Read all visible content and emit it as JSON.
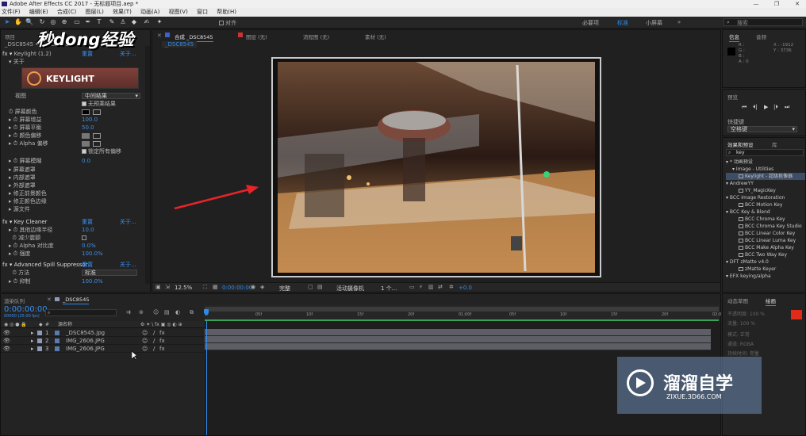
{
  "app": {
    "title": "Adobe After Effects CC 2017 - 无标题项目.aep *",
    "win_minimize": "—",
    "win_maximize": "❐",
    "win_close": "✕"
  },
  "menu": [
    "文件(F)",
    "编辑(E)",
    "合成(C)",
    "图层(L)",
    "效果(T)",
    "动画(A)",
    "视图(V)",
    "窗口",
    "帮助(H)"
  ],
  "toolbar": {
    "snap_label": "对齐",
    "workspaces": [
      "必要项",
      "标准",
      "小屏幕"
    ],
    "active_workspace": "标准",
    "search_placeholder": "搜索",
    "more": "»"
  },
  "left_panel": {
    "tab_project": "项目",
    "tab_effect_controls": "效果控件",
    "layer_name": "_DSC8545 • _DSC8545",
    "effect_name": "Keylight (1.2)",
    "reset": "重置",
    "about": "关于...",
    "about_label": "关于",
    "logo_text": "KEYLIGHT",
    "view_label": "视图",
    "view_value": "中间结果",
    "unpremultiply_label": "无预乘结果",
    "props": [
      {
        "label": "屏幕颜色",
        "value": ""
      },
      {
        "label": "屏幕增益",
        "value": "100.0"
      },
      {
        "label": "屏幕平衡",
        "value": "50.0"
      },
      {
        "label": "颜色偏移",
        "value": ""
      },
      {
        "label": "Alpha 偏移",
        "value": ""
      }
    ],
    "lock_bias_label": "锁定所有偏移",
    "screen_blur_label": "屏幕模糊",
    "screen_blur_value": "0.0",
    "groups": [
      "屏幕遮罩",
      "内部遮罩",
      "外部遮罩",
      "修正前景颜色",
      "修正颜色边缘",
      "源文件"
    ],
    "key_cleaner": {
      "name": "Key Cleaner",
      "reset": "重置",
      "about": "关于...",
      "props": [
        {
          "label": "其他边缘半径",
          "value": "10.0"
        },
        {
          "label": "减少震颤",
          "value": ""
        },
        {
          "label": "Alpha 对比度",
          "value": "0.0%"
        },
        {
          "label": "强度",
          "value": "100.0%"
        }
      ]
    },
    "spill": {
      "name": "Advanced Spill Suppressor",
      "reset": "重置",
      "about": "关于...",
      "method_label": "方法",
      "method_value": "标准",
      "suppression_label": "抑制",
      "suppression_value": "100.0%"
    }
  },
  "viewer": {
    "comp_tab": "合成 _DSC8545",
    "layer_tab": "图层 (无)",
    "flow_tab": "流程图 (无)",
    "footage_tab": "素材 (无)",
    "comp_sub_tab": "_DSC8545",
    "zoom": "12.5%",
    "timecode": "0:00:00:00",
    "quality": "完整",
    "camera": "活动摄像机",
    "views": "1 个...",
    "exposure": "+0.0"
  },
  "watermark_top": "秒dong经验",
  "info_panel": {
    "tab_info": "信息",
    "tab_audio": "音频",
    "r": "R :",
    "g": "G :",
    "b": "B :",
    "a": "A : 0",
    "x": "X : -1912",
    "y": "Y : 3736"
  },
  "preview_panel": {
    "title": "预览",
    "shortcut_label": "快捷键",
    "shortcut_value": "空格键"
  },
  "effects_panel": {
    "tab": "效果和预设",
    "tab2": "库",
    "search_value": "key",
    "tree": [
      {
        "level": 0,
        "label": "* 动画预设",
        "fx": false
      },
      {
        "level": 1,
        "label": "Image - Utilities",
        "fx": false
      },
      {
        "level": 2,
        "label": "Keylight - 超级抠像器",
        "fx": true,
        "highlight": true
      },
      {
        "level": 0,
        "label": "AndrewYY",
        "fx": false
      },
      {
        "level": 2,
        "label": "YY_MagicKey",
        "fx": true
      },
      {
        "level": 0,
        "label": "BCC Image Restoration",
        "fx": false
      },
      {
        "level": 2,
        "label": "BCC Motion Key",
        "fx": true
      },
      {
        "level": 0,
        "label": "BCC Key & Blend",
        "fx": false
      },
      {
        "level": 2,
        "label": "BCC Chroma Key",
        "fx": true
      },
      {
        "level": 2,
        "label": "BCC Chroma Key Studio",
        "fx": true
      },
      {
        "level": 2,
        "label": "BCC Linear Color Key",
        "fx": true
      },
      {
        "level": 2,
        "label": "BCC Linear Luma Key",
        "fx": true
      },
      {
        "level": 2,
        "label": "BCC Make Alpha Key",
        "fx": true
      },
      {
        "level": 2,
        "label": "BCC Two Way Key",
        "fx": true
      },
      {
        "level": 0,
        "label": "DFT zMatte v4.0",
        "fx": false
      },
      {
        "level": 2,
        "label": "zMatte Keyer",
        "fx": true
      },
      {
        "level": 0,
        "label": "EFX keying/alpha",
        "fx": false
      }
    ]
  },
  "bottom_right": {
    "tab_tracker": "动态草图",
    "tab_paint": "绘画",
    "brush_labels": [
      "不透明度: 100 %",
      "流量: 100 %",
      "模式: 正常",
      "通道: RGBA",
      "持续时间: 常量"
    ]
  },
  "timeline": {
    "tab_render": "渲染队列",
    "tab_comp": "_DSC8545",
    "timecode": "0:00:00:00",
    "fps": "00000 (25.00 fps)",
    "search_placeholder": "",
    "col_num": "#",
    "col_source": "源名称",
    "ruler_marks": [
      "0f",
      "05f",
      "10f",
      "15f",
      "20f",
      "01:00f",
      "05f",
      "10f",
      "15f",
      "20f",
      "02:0"
    ],
    "layers": [
      {
        "num": "1",
        "name": "_DSC8545.jpg"
      },
      {
        "num": "2",
        "name": "IMG_2606.JPG"
      },
      {
        "num": "3",
        "name": "IMG_2606.JPG"
      }
    ]
  },
  "watermark_bottom": {
    "cn": "溜溜自学",
    "url": "ZIXUE.3D66.COM"
  },
  "colors": {
    "accent": "#2d8ceb",
    "timecode": "#3a8ff0",
    "arrow": "#e8242a",
    "paint_fg": "#e02a1a"
  }
}
